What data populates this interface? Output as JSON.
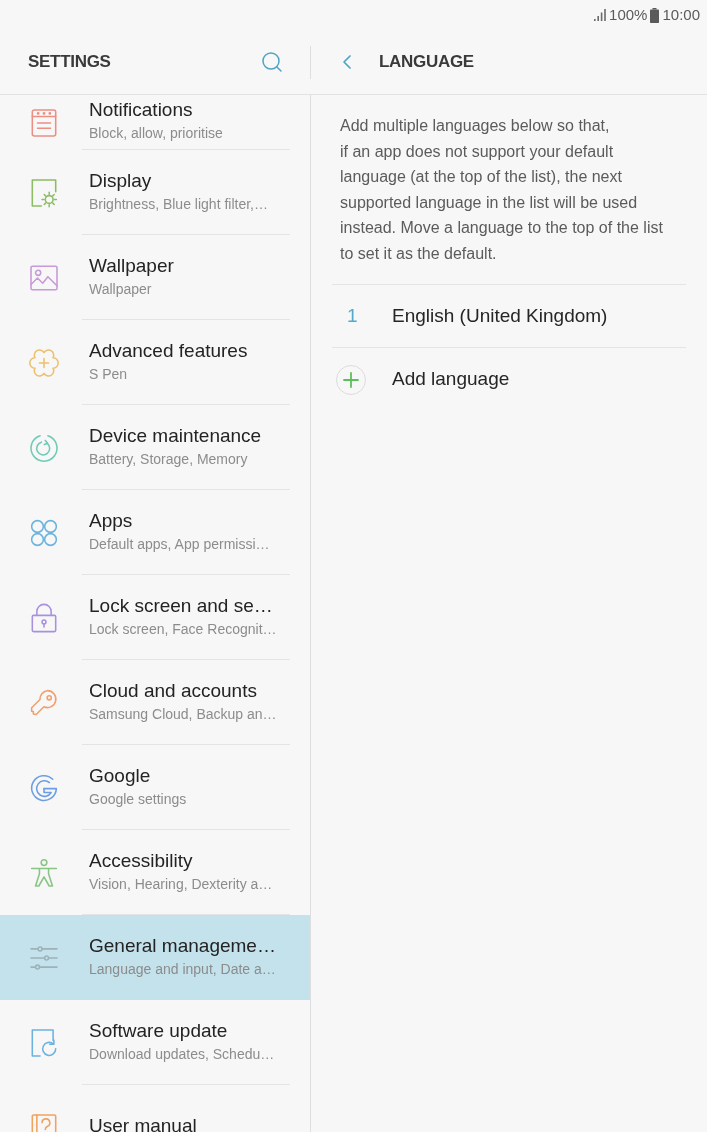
{
  "status_bar": {
    "battery": "100%",
    "time": "10:00"
  },
  "settings": {
    "title": "SETTINGS",
    "items": [
      {
        "kind": "notifications",
        "title": "Notifications",
        "subtitle": "Block, allow, prioritise",
        "selected": false
      },
      {
        "kind": "display",
        "title": "Display",
        "subtitle": "Brightness, Blue light filter,…",
        "selected": false
      },
      {
        "kind": "wallpaper",
        "title": "Wallpaper",
        "subtitle": "Wallpaper",
        "selected": false
      },
      {
        "kind": "advanced",
        "title": "Advanced features",
        "subtitle": "S Pen",
        "selected": false
      },
      {
        "kind": "maintenance",
        "title": "Device maintenance",
        "subtitle": "Battery, Storage, Memory",
        "selected": false
      },
      {
        "kind": "apps",
        "title": "Apps",
        "subtitle": "Default apps, App permissi…",
        "selected": false
      },
      {
        "kind": "lock",
        "title": "Lock screen and se…",
        "subtitle": "Lock screen, Face Recognit…",
        "selected": false
      },
      {
        "kind": "cloud",
        "title": "Cloud and accounts",
        "subtitle": "Samsung Cloud, Backup an…",
        "selected": false
      },
      {
        "kind": "google",
        "title": "Google",
        "subtitle": "Google settings",
        "selected": false
      },
      {
        "kind": "accessibility",
        "title": "Accessibility",
        "subtitle": "Vision, Hearing, Dexterity a…",
        "selected": false
      },
      {
        "kind": "general",
        "title": "General manageme…",
        "subtitle": "Language and input, Date a…",
        "selected": true
      },
      {
        "kind": "software",
        "title": "Software update",
        "subtitle": "Download updates, Schedu…",
        "selected": false
      },
      {
        "kind": "manual",
        "title": "User manual",
        "selected": false
      }
    ]
  },
  "language": {
    "title": "LANGUAGE",
    "description": "Add multiple languages below so that,\nif an app does not support your default language (at the top of the list), the next supported language in the list will be used instead. Move a language to the top of the list to set it as the default.",
    "languages": [
      {
        "number": "1",
        "name": "English (United Kingdom)"
      }
    ],
    "add_button": "Add language"
  }
}
